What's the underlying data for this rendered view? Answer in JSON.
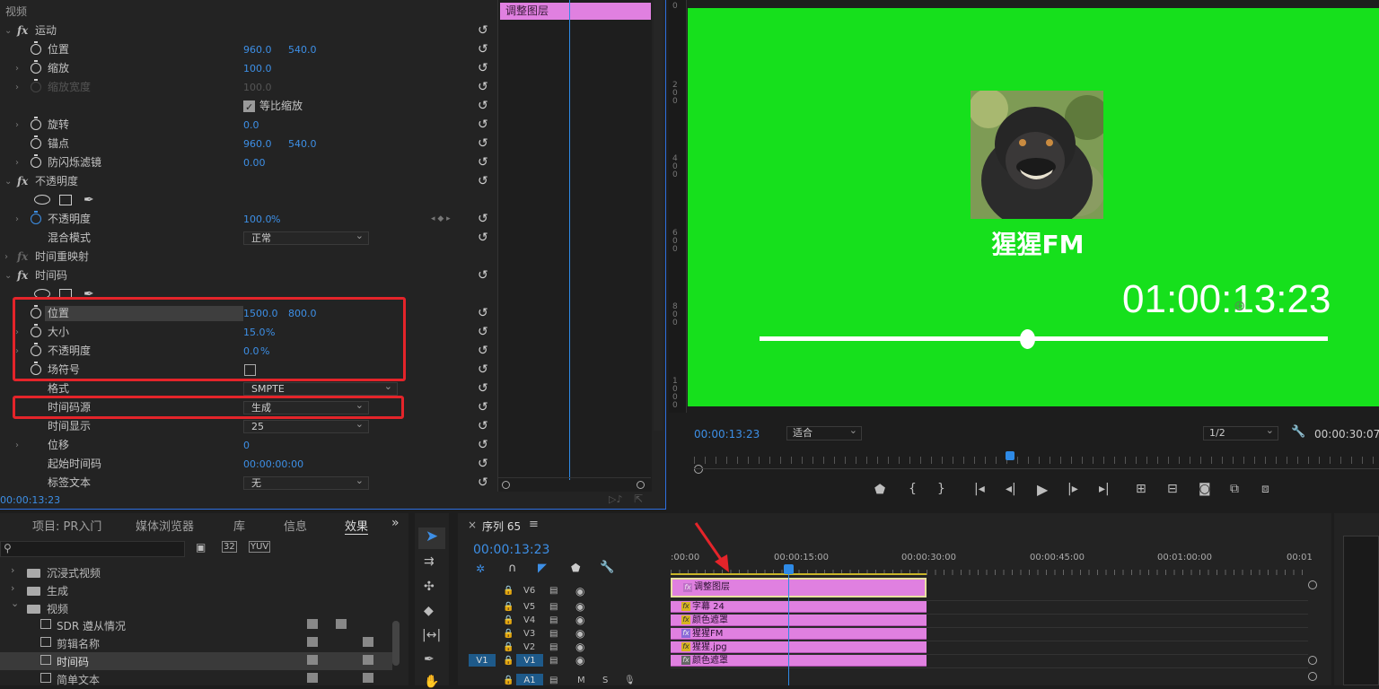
{
  "effects": {
    "header": "视频",
    "motion": {
      "title": "运动",
      "position_label": "位置",
      "position_x": "960.0",
      "position_y": "540.0",
      "scale_label": "缩放",
      "scale_value": "100.0",
      "scale_width_label": "缩放宽度",
      "scale_width_value": "100.0",
      "uniform_scale_label": "等比缩放",
      "rotation_label": "旋转",
      "rotation_value": "0.0",
      "anchor_label": "锚点",
      "anchor_x": "960.0",
      "anchor_y": "540.0",
      "antiflicker_label": "防闪烁滤镜",
      "antiflicker_value": "0.00"
    },
    "opacity": {
      "title": "不透明度",
      "opacity_label": "不透明度",
      "opacity_value": "100.0",
      "opacity_unit": "%",
      "blend_label": "混合模式",
      "blend_value": "正常"
    },
    "time_remap": {
      "title": "时间重映射"
    },
    "timecode": {
      "title": "时间码",
      "position_label": "位置",
      "position_x": "1500.0",
      "position_y": "800.0",
      "size_label": "大小",
      "size_value": "15.0",
      "size_unit": "%",
      "opacity_label": "不透明度",
      "opacity_value": "0.0",
      "opacity_unit": "%",
      "field_label": "场符号",
      "format_label": "格式",
      "format_value": "SMPTE",
      "source_label": "时间码源",
      "source_value": "生成",
      "display_label": "时间显示",
      "display_value": "25",
      "offset_label": "位移",
      "offset_value": "0",
      "start_label": "起始时间码",
      "start_value": "00:00:00:00",
      "tag_label": "标签文本",
      "tag_value": "无"
    },
    "clip_name": "调整图层",
    "current_time": "00:00:13:23"
  },
  "monitor": {
    "title_text": "猩猩FM",
    "timecode_overlay": "01:00:13:23",
    "current_time": "00:00:13:23",
    "fit_label": "适合",
    "resolution": "1/2",
    "duration": "00:00:30:07",
    "ruler_marks": [
      "0",
      "2\n0\n0",
      "4\n0\n0",
      "6\n0\n0",
      "8\n0\n0",
      "1\n0\n0\n0"
    ],
    "slider_progress": 0.47,
    "colors": {
      "green_screen": "#16e01c",
      "accent": "#2e8ae6"
    }
  },
  "project": {
    "tabs": [
      "项目: PR入门",
      "媒体浏览器",
      "库",
      "信息",
      "效果"
    ],
    "active_tab": "效果",
    "tree": [
      {
        "label": "沉浸式视频",
        "type": "folder",
        "level": 1
      },
      {
        "label": "生成",
        "type": "folder",
        "level": 1
      },
      {
        "label": "视频",
        "type": "folder",
        "level": 1,
        "open": true
      },
      {
        "label": "SDR 遵从情况",
        "type": "effect",
        "level": 2
      },
      {
        "label": "剪辑名称",
        "type": "effect",
        "level": 2
      },
      {
        "label": "时间码",
        "type": "effect",
        "level": 2,
        "selected": true
      },
      {
        "label": "简单文本",
        "type": "effect",
        "level": 2
      }
    ]
  },
  "timeline": {
    "sequence_name": "序列 65",
    "current_time": "00:00:13:23",
    "ruler": [
      ":00:00",
      "00:00:15:00",
      "00:00:30:00",
      "00:00:45:00",
      "00:01:00:00",
      "00:01"
    ],
    "tracks": [
      {
        "name": "V6",
        "clip": "调整图层"
      },
      {
        "name": "V5",
        "clip": "字幕 24"
      },
      {
        "name": "V4",
        "clip": "颜色遮罩"
      },
      {
        "name": "V3",
        "clip": "猩猩FM"
      },
      {
        "name": "V2",
        "clip": "猩猩.jpg"
      },
      {
        "name": "V1",
        "clip": "颜色遮罩"
      }
    ],
    "source_patch": "V1",
    "audio_track": "A1",
    "audio_m": "M",
    "audio_s": "S"
  }
}
